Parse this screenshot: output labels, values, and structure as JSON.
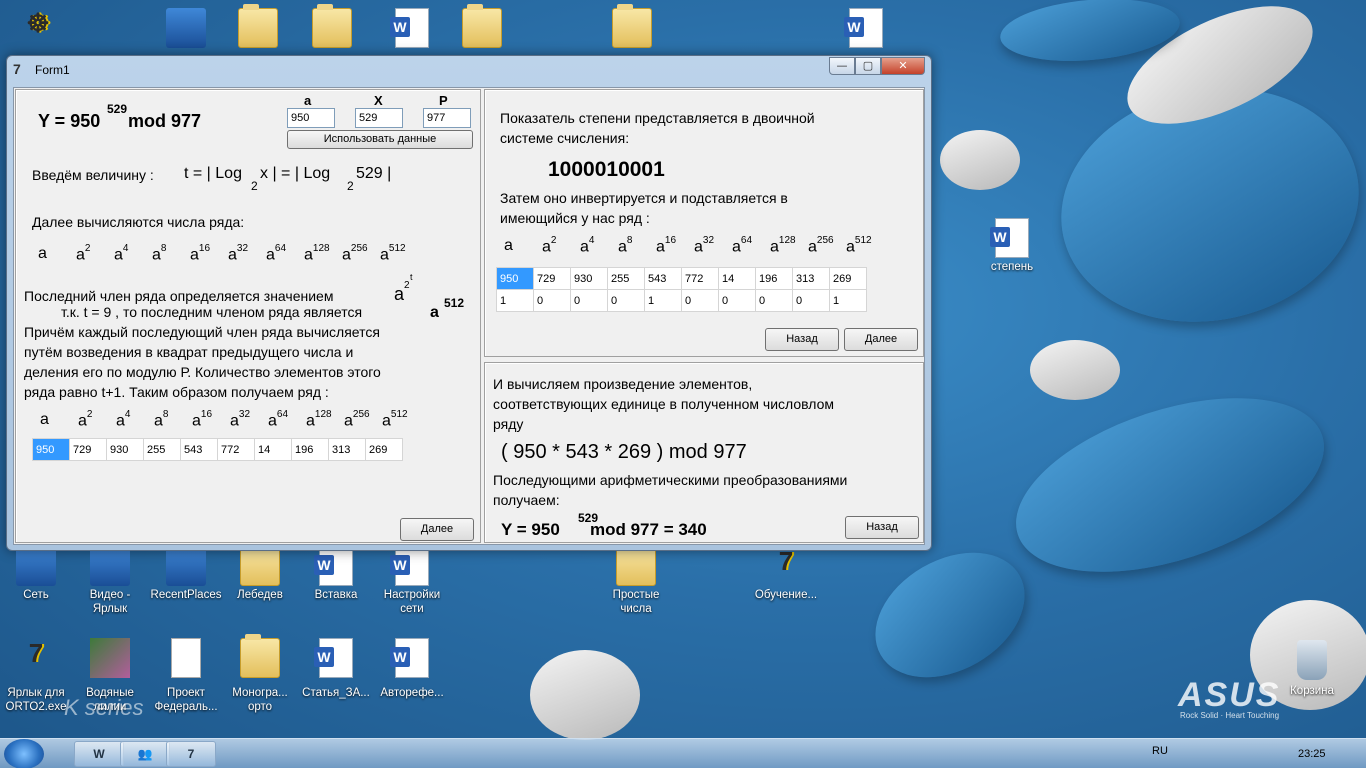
{
  "desktop": {
    "top_icons": [
      "",
      "",
      "",
      "",
      "",
      "",
      ""
    ],
    "right_icons": [
      {
        "label": "степень"
      },
      {
        "label": "Корзина"
      }
    ],
    "row1_icons": [
      {
        "label": "Сеть"
      },
      {
        "label": "Видео -\nЯрлык"
      },
      {
        "label": "RecentPlaces"
      },
      {
        "label": "Лебедев"
      },
      {
        "label": "Вставка"
      },
      {
        "label": "Настройки\nсети"
      },
      {
        "label": "Простые\nчисла"
      },
      {
        "label": "Обучение..."
      }
    ],
    "row2_icons": [
      {
        "label": "Ярлык для\nORTO2.exe"
      },
      {
        "label": "Водяные\nлилии"
      },
      {
        "label": "Проект\nФедераль..."
      },
      {
        "label": "Моногра...\nорто"
      },
      {
        "label": "Статья_ЗА..."
      },
      {
        "label": "Авторефе..."
      }
    ],
    "watermark_left": "K series",
    "brand": "ASUS",
    "brand_tagline": "Rock Solid · Heart Touching"
  },
  "window": {
    "title": "Form1",
    "controls": {
      "minimize": "—",
      "maximize": "▢",
      "close": "✕"
    }
  },
  "left_panel": {
    "formula": "Y = 950",
    "formula_exp": "529",
    "formula_mod": "mod 977",
    "field_labels": {
      "a": "a",
      "x": "X",
      "p": "P"
    },
    "field_values": {
      "a": "950",
      "x": "529",
      "p": "977"
    },
    "use_data_button": "Использовать данные",
    "intro_text": "Введём величину :",
    "t_def_1": "t = | Log",
    "t_def_sub1": "2",
    "t_def_2": "x |  = | Log",
    "t_def_sub2": "2",
    "t_def_3": "529 |",
    "series_intro": "Далее вычисляются числа ряда:",
    "series_terms": [
      {
        "base": "a",
        "exp": ""
      },
      {
        "base": "a",
        "exp": "2"
      },
      {
        "base": "a",
        "exp": "4"
      },
      {
        "base": "a",
        "exp": "8"
      },
      {
        "base": "a",
        "exp": "16"
      },
      {
        "base": "a",
        "exp": "32"
      },
      {
        "base": "a",
        "exp": "64"
      },
      {
        "base": "a",
        "exp": "128"
      },
      {
        "base": "a",
        "exp": "256"
      },
      {
        "base": "a",
        "exp": "512"
      }
    ],
    "last_term_text": "Последний член ряда определяется значением",
    "last_term_sym": "a",
    "last_term_exp1": "2",
    "last_term_exp2": "t",
    "tk_text": "т.к.  t = 9  , то  последним членом ряда является",
    "tk_sym": "a",
    "tk_exp": "512",
    "explain": [
      "Причём каждый последующий член ряда вычисляется",
      "путём возведения в квадрат предыдущего числа и",
      "деления его по модулю Р. Количество элементов этого",
      "ряда равно t+1. Таким образом получаем ряд :"
    ],
    "grid_values": [
      "950",
      "729",
      "930",
      "255",
      "543",
      "772",
      "14",
      "196",
      "313",
      "269"
    ],
    "next_button": "Далее"
  },
  "right_top_panel": {
    "text1": "Показатель степени представляется в двоичной",
    "text2": "системе счисления:",
    "binary": "1000010001",
    "text3": "Затем оно инвертируется  и подставляется в",
    "text4": "имеющийся у нас ряд :",
    "grid_row1": [
      "950",
      "729",
      "930",
      "255",
      "543",
      "772",
      "14",
      "196",
      "313",
      "269"
    ],
    "grid_row2": [
      "1",
      "0",
      "0",
      "0",
      "1",
      "0",
      "0",
      "0",
      "0",
      "1"
    ],
    "back_button": "Назад",
    "next_button": "Далее"
  },
  "right_bottom_panel": {
    "text1": "И вычисляем произведение элементов,",
    "text2": "соответствующих единице в полученном числовлом",
    "text3": "ряду",
    "product": "( 950 * 543 * 269 ) mod 977",
    "text4": "Последующими арифметическими преобразованиями",
    "text5": "получаем:",
    "result_a": "Y = 950",
    "result_exp": "529",
    "result_b": "mod 977  = 340",
    "back_button": "Назад"
  },
  "taskbar": {
    "items": [
      "W",
      "👥",
      "7"
    ],
    "lang": "RU",
    "time": "23:25"
  }
}
